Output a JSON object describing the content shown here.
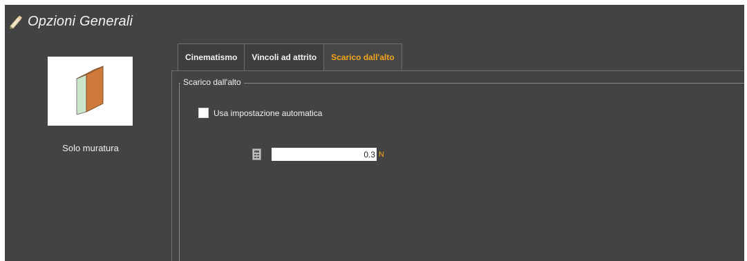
{
  "window": {
    "title": "Opzioni Generali",
    "title_icon": "pencil-icon"
  },
  "left_panel": {
    "preview_icon": "masonry-wall-icon",
    "caption": "Solo muratura"
  },
  "tabs": [
    {
      "label": "Cinematismo",
      "active": false
    },
    {
      "label": "Vincoli ad attrito",
      "active": false
    },
    {
      "label": "Scarico dall'alto",
      "active": true
    }
  ],
  "group": {
    "title": "Scarico dall'alto",
    "auto_checkbox": {
      "label": "Usa impostazione automatica",
      "checked": false
    },
    "value_field": {
      "value": "0.3",
      "unit": "N",
      "icon": "calculator-icon"
    }
  },
  "colors": {
    "background": "#434343",
    "accent": "#f2a51b",
    "text": "#f2f2f2"
  }
}
